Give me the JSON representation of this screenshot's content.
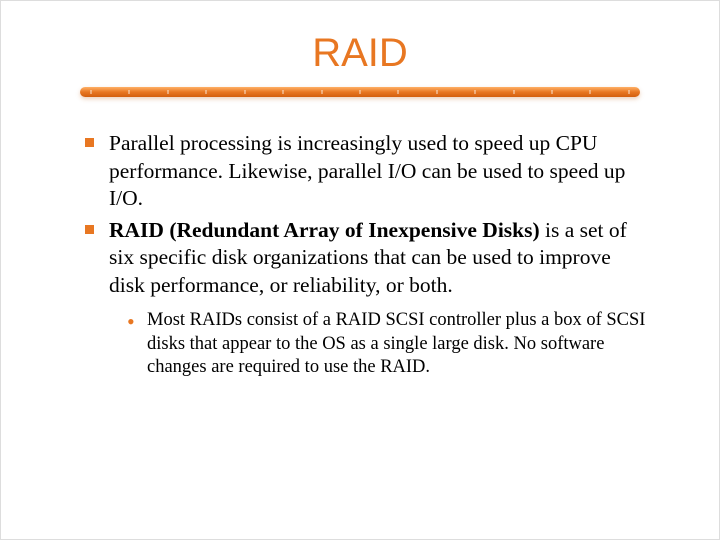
{
  "title": "RAID",
  "bullets": {
    "b1_pre": "Parallel processing is increasingly used to speed up CPU performance. Likewise, parallel I/O can be used to speed up I/O.",
    "b2_strong": "RAID (Redundant Array of Inexpensive Disks)",
    "b2_rest": " is a set of six specific disk organizations that can be used to improve disk performance, or reliability, or both."
  },
  "sub": {
    "s1": "Most RAIDs consist of a RAID SCSI controller plus a box of SCSI disks that appear to the OS as a single large disk. No software changes are required to use the RAID."
  },
  "colors": {
    "accent": "#e87722"
  }
}
